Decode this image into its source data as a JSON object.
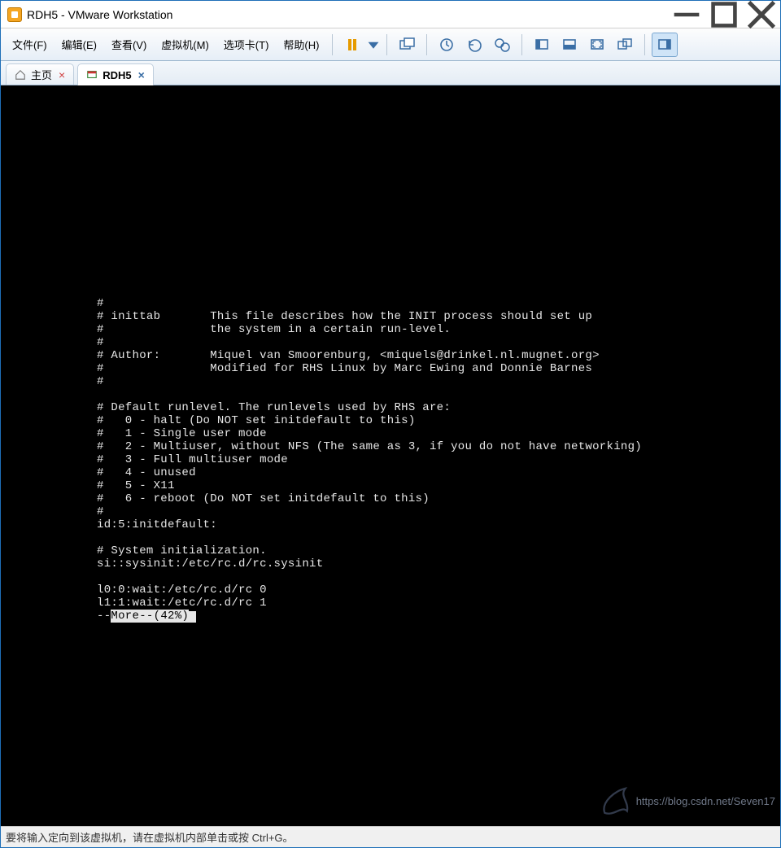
{
  "window": {
    "title": "RDH5 - VMware Workstation"
  },
  "menu": {
    "file": "文件(F)",
    "edit": "编辑(E)",
    "view": "查看(V)",
    "vm": "虚拟机(M)",
    "tabs": "选项卡(T)",
    "help": "帮助(H)"
  },
  "tabs": {
    "home": "主页",
    "vm": "RDH5"
  },
  "terminal": {
    "lines": [
      "#",
      "# inittab       This file describes how the INIT process should set up",
      "#               the system in a certain run-level.",
      "#",
      "# Author:       Miquel van Smoorenburg, <miquels@drinkel.nl.mugnet.org>",
      "#               Modified for RHS Linux by Marc Ewing and Donnie Barnes",
      "#",
      "",
      "# Default runlevel. The runlevels used by RHS are:",
      "#   0 - halt (Do NOT set initdefault to this)",
      "#   1 - Single user mode",
      "#   2 - Multiuser, without NFS (The same as 3, if you do not have networking)",
      "#   3 - Full multiuser mode",
      "#   4 - unused",
      "#   5 - X11",
      "#   6 - reboot (Do NOT set initdefault to this)",
      "#",
      "id:5:initdefault:",
      "",
      "# System initialization.",
      "si::sysinit:/etc/rc.d/rc.sysinit",
      "",
      "l0:0:wait:/etc/rc.d/rc 0",
      "l1:1:wait:/etc/rc.d/rc 1"
    ],
    "more_prefix": "--",
    "more_label": "More--(42%)"
  },
  "status": {
    "text": "要将输入定向到该虚拟机，请在虚拟机内部单击或按 Ctrl+G。"
  },
  "watermark": {
    "text": "https://blog.csdn.net/Seven17"
  }
}
